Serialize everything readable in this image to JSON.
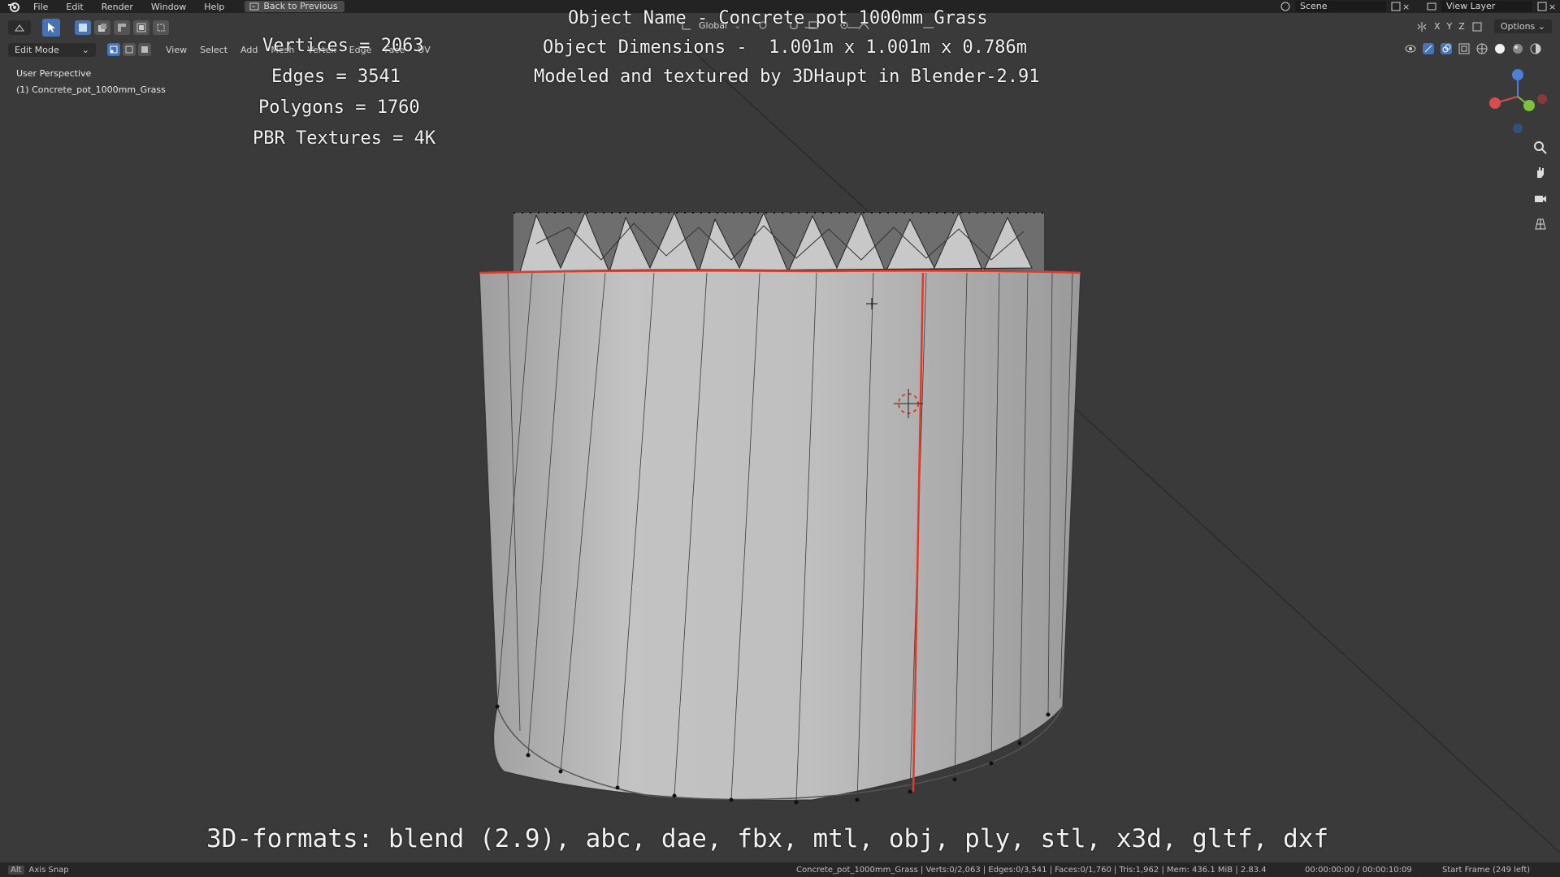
{
  "menu": [
    "File",
    "Edit",
    "Render",
    "Window",
    "Help"
  ],
  "back_button": "Back to Previous",
  "scene_label": "Scene",
  "view_layer_label": "View Layer",
  "header": {
    "mode": "Edit Mode",
    "menus": [
      "View",
      "Select",
      "Add",
      "Mesh",
      "Vertex",
      "Edge",
      "Face",
      "UV"
    ],
    "transform_orientation": "Global",
    "axis_labels": [
      "X",
      "Y",
      "Z"
    ],
    "options": "Options"
  },
  "viewport": {
    "perspective": "User Perspective",
    "object": "(1) Concrete_pot_1000mm_Grass"
  },
  "overlay": {
    "vertices": "Vertices = 2063",
    "edges": "Edges = 3541",
    "polygons": "Polygons = 1760",
    "textures": "PBR Textures = 4K",
    "object_name": "Object Name - Concrete_pot_1000mm_Grass",
    "dimensions": "Object Dimensions -  1.001m x 1.001m x 0.786m",
    "credit": "Modeled and textured by 3DHaupt in Blender-2.91",
    "formats": "3D-formats: blend (2.9), abc, dae, fbx, mtl, obj, ply, stl, x3d, gltf, dxf"
  },
  "status": {
    "left_key": "Alt",
    "left": "Axis Snap",
    "info": "Concrete_pot_1000mm_Grass | Verts:0/2,063 | Edges:0/3,541 | Faces:0/1,760 | Tris:1,962 | Mem: 436.1 MiB | 2.83.4",
    "time": "00:00:00:00 / 00:00:10:09",
    "frame": "Start Frame (249 left)"
  },
  "colors": {
    "accent": "#4772b3",
    "seam": "#e03a2a",
    "mesh_face": "#b9b9b9",
    "background": "#3a3a3a"
  }
}
